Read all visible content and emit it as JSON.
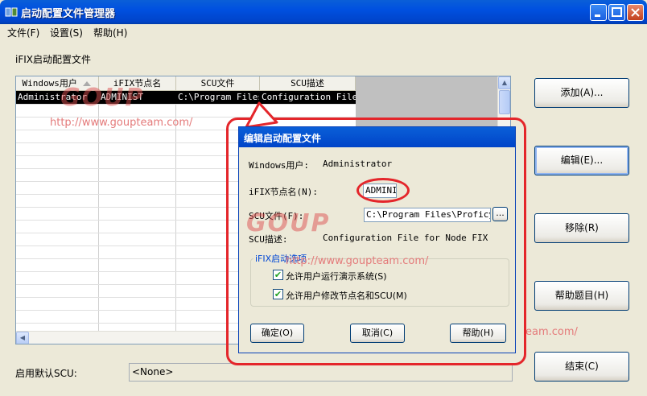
{
  "window": {
    "title": "启动配置文件管理器"
  },
  "menu": [
    {
      "label": "文件(F)"
    },
    {
      "label": "设置(S)"
    },
    {
      "label": "帮助(H)"
    }
  ],
  "list_section_label": "iFIX启动配置文件",
  "table": {
    "columns": [
      "Windows用户",
      "iFIX节点名",
      "SCU文件",
      "SCU描述"
    ],
    "rows": [
      [
        "Administrator",
        "ADMINIST",
        "C:\\Program Files\\",
        "Configuration File f"
      ]
    ]
  },
  "buttons": {
    "add": "添加(A)...",
    "edit": "编辑(E)...",
    "remove": "移除(R)",
    "help_topics": "帮助题目(H)",
    "finish": "结束(C)"
  },
  "default_scu": {
    "label": "启用默认SCU:",
    "value": "<None>"
  },
  "dialog": {
    "title": "编辑启动配置文件",
    "windows_user_label": "Windows用户:",
    "windows_user_value": "Administrator",
    "node_label": "iFIX节点名(N):",
    "node_value": "ADMINI",
    "scu_file_label": "SCU文件(F):",
    "scu_file_value": "C:\\Program Files\\Proficy\\P",
    "browse_label": "...",
    "scu_desc_label": "SCU描述:",
    "scu_desc_value": "Configuration File for Node FIX",
    "group_title": "iFIX启动选项",
    "option1": "允许用户运行演示系统(S)",
    "option2": "允许用户修改节点名和SCU(M)",
    "ok": "确定(O)",
    "cancel": "取消(C)",
    "help": "帮助(H)"
  },
  "watermark": {
    "brand": "GOUP",
    "url1": "http://www.goupteam.com/",
    "url2": "http://www.goupteam.com/",
    "url3": "eam.com/"
  }
}
